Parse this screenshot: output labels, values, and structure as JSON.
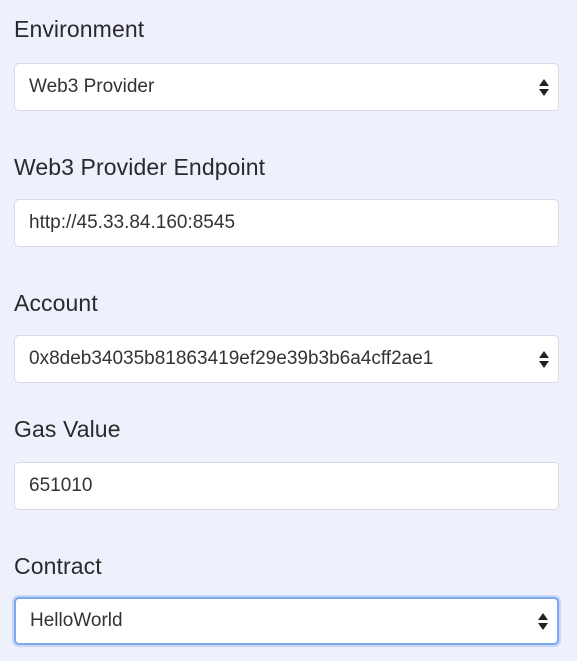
{
  "environment": {
    "label": "Environment",
    "selected": "Web3 Provider"
  },
  "endpoint": {
    "label": "Web3 Provider Endpoint",
    "value": "http://45.33.84.160:8545"
  },
  "account": {
    "label": "Account",
    "selected": "0x8deb34035b81863419ef29e39b3b6a4cff2ae1"
  },
  "gas": {
    "label": "Gas Value",
    "value": "651010"
  },
  "contract": {
    "label": "Contract",
    "selected": "HelloWorld"
  },
  "icons": {
    "select_arrows": "select-updown-icon"
  }
}
